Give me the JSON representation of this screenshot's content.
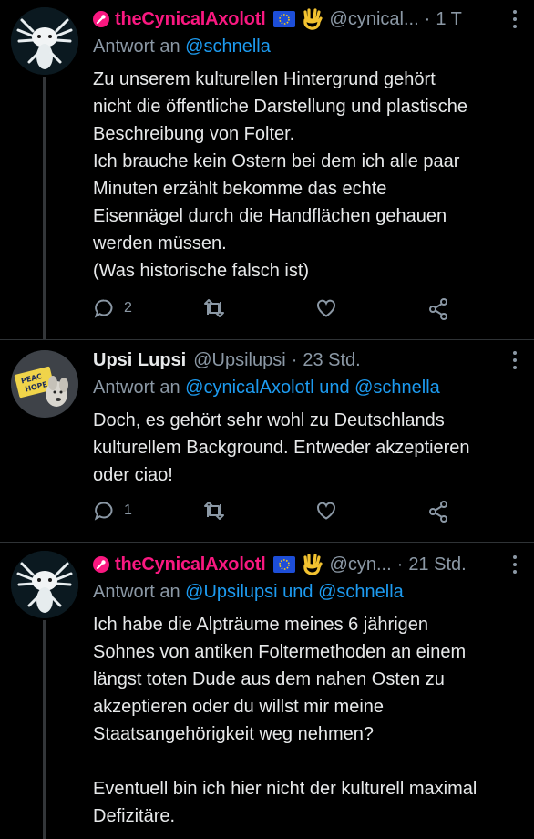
{
  "tweets": [
    {
      "display_name": "theCynicalAxolotl",
      "handle": "@cynical...",
      "time": "1 T",
      "reply_prefix": "Antwort an",
      "reply_to": "@schnella",
      "body": "Zu unserem kulturellen Hintergrund gehört\nnicht die öffentliche Darstellung und plastische\nBeschreibung von Folter.\nIch brauche kein Ostern bei dem ich alle paar\nMinuten erzählt bekomme das echte\nEisennägel durch die Handflächen gehauen\nwerden müssen.\n(Was historische falsch ist)",
      "reply_count": "2",
      "retweet_count": "",
      "like_count": ""
    },
    {
      "display_name": "Upsi Lupsi",
      "handle": "@Upsilupsi",
      "time": "23 Std.",
      "reply_prefix": "Antwort an",
      "reply_to": "@cynicalAxolotl und @schnella",
      "body": "Doch, es gehört sehr wohl zu Deutschlands\nkulturellem Background. Entweder akzeptieren\noder ciao!",
      "reply_count": "1",
      "retweet_count": "",
      "like_count": ""
    },
    {
      "display_name": "theCynicalAxolotl",
      "handle": "@cyn...",
      "time": "21 Std.",
      "reply_prefix": "Antwort an",
      "reply_to": "@Upsilupsi und @schnella",
      "body": "Ich habe die Alpträume meines 6 jährigen\nSohnes von antiken Foltermethoden an einem\nlängst  toten Dude aus dem nahen Osten zu\nakzeptieren oder du willst mir meine\nStaatsangehörigkeit weg nehmen?\n\nEventuell bin ich hier nicht der kulturell maximal\nDefizitäre."
    }
  ],
  "icons": {
    "pinned_name": "pin-icon",
    "eu_flag": "eu-flag-icon",
    "hand": "vulcan-salute-icon",
    "more": "more-icon",
    "reply": "reply-icon",
    "retweet": "retweet-icon",
    "like": "like-icon",
    "share": "share-icon"
  },
  "colors": {
    "background": "#000000",
    "text": "#e7e9ea",
    "secondary": "#8b98a5",
    "link": "#1d9bf0",
    "pink": "#f91880",
    "divider": "#2f3336"
  }
}
